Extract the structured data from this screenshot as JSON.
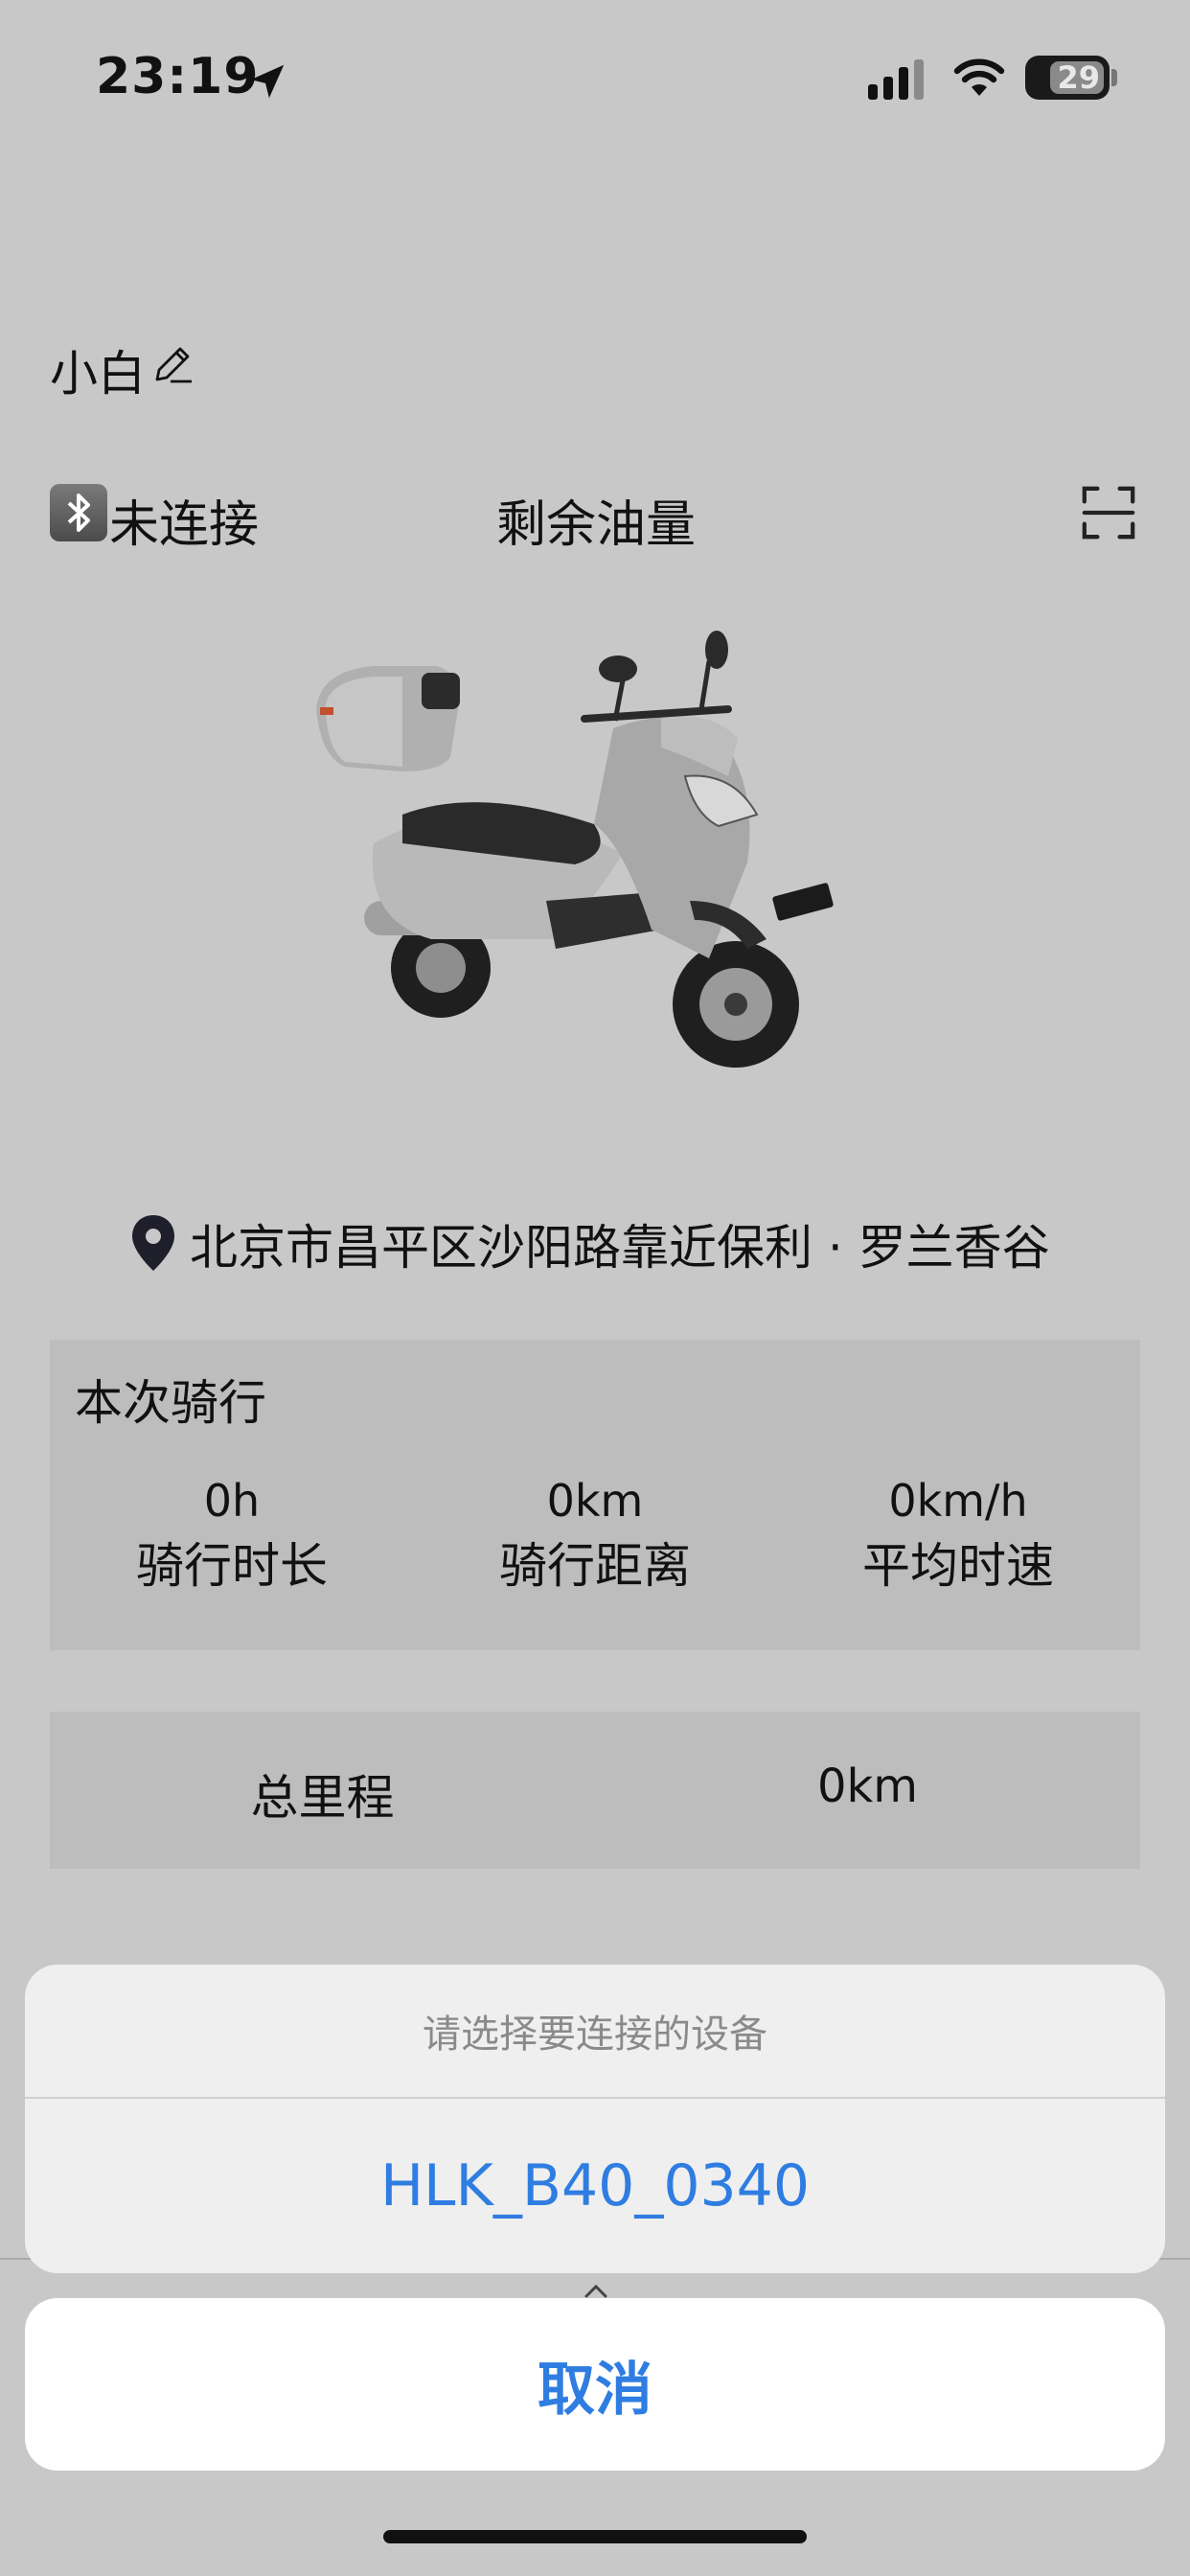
{
  "status_bar": {
    "time": "23:19",
    "battery": "29",
    "icons": [
      "location-arrow-icon",
      "cellular-signal-icon",
      "wifi-icon",
      "battery-icon"
    ]
  },
  "header": {
    "vehicle_name": "小白",
    "edit_icon": "pencil-icon"
  },
  "status_row": {
    "bluetooth_icon": "bluetooth-icon",
    "connection_status": "未连接",
    "fuel_label": "剩余油量",
    "scan_icon": "scan-icon"
  },
  "location": {
    "icon": "map-pin-icon",
    "address": "北京市昌平区沙阳路靠近保利 · 罗兰香谷"
  },
  "ride": {
    "title": "本次骑行",
    "stats": [
      {
        "value": "0h",
        "label": "骑行时长"
      },
      {
        "value": "0km",
        "label": "骑行距离"
      },
      {
        "value": "0km/h",
        "label": "平均时速"
      }
    ]
  },
  "total": {
    "label": "总里程",
    "value": "0km"
  },
  "action_sheet": {
    "title": "请选择要连接的设备",
    "options": [
      "HLK_B40_0340"
    ],
    "cancel_label": "取消"
  },
  "colors": {
    "background": "#c8c8c8",
    "panel": "#bdbdbd",
    "accent": "#2f7de1"
  }
}
